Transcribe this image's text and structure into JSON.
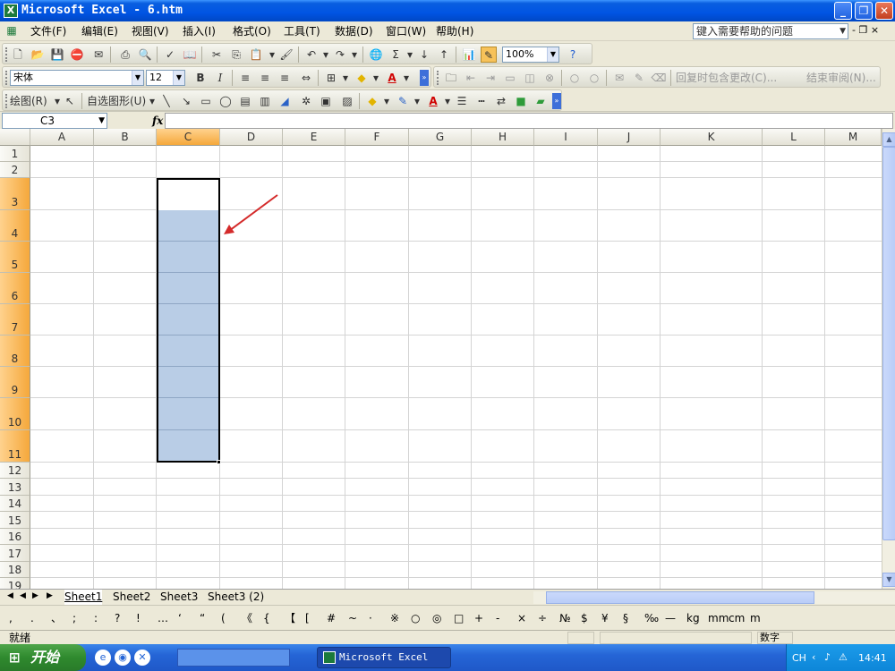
{
  "window": {
    "title": "Microsoft Excel - 6.htm",
    "app_icon": "X",
    "buttons": [
      "_",
      "❐",
      "✕"
    ]
  },
  "menubar": {
    "items": [
      "文件(F)",
      "编辑(E)",
      "视图(V)",
      "插入(I)",
      "格式(O)",
      "工具(T)",
      "数据(D)",
      "窗口(W)",
      "帮助(H)"
    ],
    "help_placeholder": "键入需要帮助的问题",
    "mdi_buttons": "- ❐ ×"
  },
  "standard_toolbar": {
    "zoom": "100%"
  },
  "format_toolbar": {
    "font": "宋体",
    "font_size": "12",
    "bold": "B",
    "italic": "I",
    "review_reply": "回复时包含更改(C)...",
    "review_end": "结束审阅(N)..."
  },
  "drawing_toolbar": {
    "draw": "绘图(R)",
    "autoshapes": "自选图形(U)"
  },
  "formula_bar": {
    "name_box": "C3",
    "fx": "fx",
    "formula": ""
  },
  "grid": {
    "columns": [
      "A",
      "B",
      "C",
      "D",
      "E",
      "F",
      "G",
      "H",
      "I",
      "J",
      "K",
      "L",
      "M"
    ],
    "selected_column": "C",
    "rows": [
      "1",
      "2",
      "3",
      "4",
      "5",
      "6",
      "7",
      "8",
      "9",
      "10",
      "11",
      "12",
      "13",
      "14",
      "15",
      "16",
      "17",
      "18",
      "19"
    ],
    "selected_range": "C3:C11",
    "active_cell": "C3",
    "annotation": "red-arrow"
  },
  "sheets": {
    "tabs": [
      "Sheet1",
      "Sheet2",
      "Sheet3",
      "Sheet3 (2)"
    ],
    "active": "Sheet1"
  },
  "symbol_bar": {
    "symbols": [
      ",",
      ".",
      "、",
      ";",
      ":",
      "?",
      "!",
      "…",
      "‘",
      "“",
      "(",
      "《",
      "{",
      "【",
      "[",
      "#",
      "~",
      "·",
      "※",
      "○",
      "◎",
      "□",
      "+",
      "-",
      "×",
      "÷",
      "№",
      "$",
      "¥",
      "§",
      "‰",
      "—",
      "kg",
      "mm",
      "cm",
      "m"
    ]
  },
  "status": {
    "text": "就绪",
    "mode": "数字"
  },
  "taskbar": {
    "start": "开始",
    "task": "Microsoft Excel ...",
    "lang": "CH",
    "clock": "14:41"
  },
  "colors": {
    "selection_fill": "#b9cde6",
    "header_selected": "#f5a83b",
    "annotation_arrow": "#d42a2a",
    "titlebar": "#0054e3"
  }
}
